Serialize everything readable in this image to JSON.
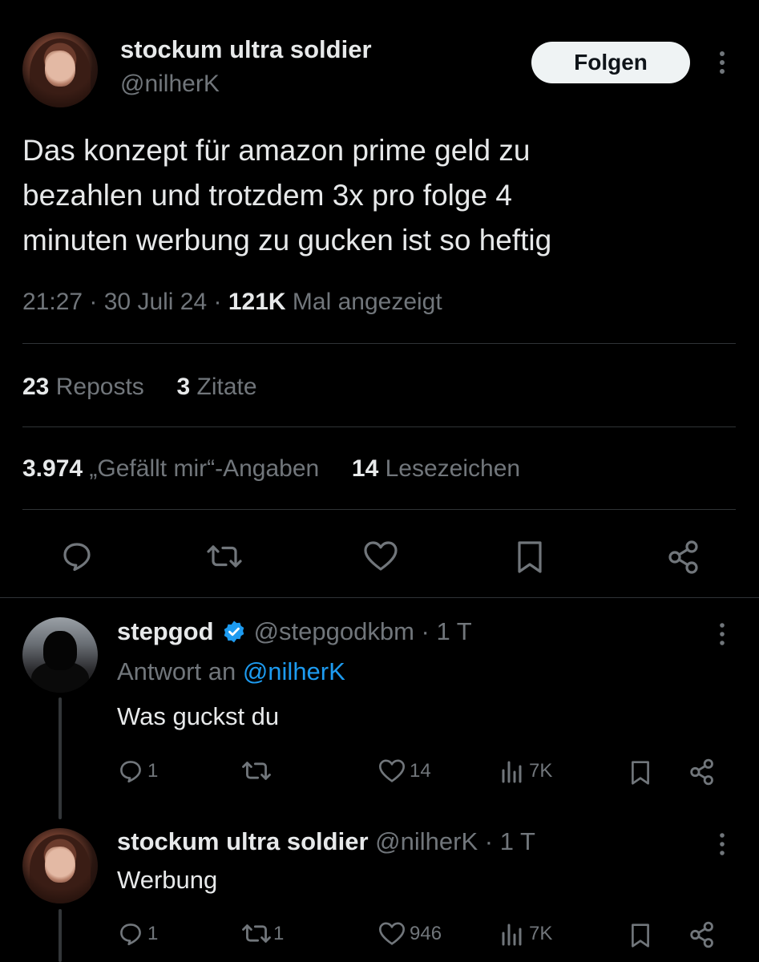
{
  "main_tweet": {
    "author_name": "stockum ultra soldier",
    "author_handle": "@nilherK",
    "follow_label": "Folgen",
    "text_lines": [
      "Das konzept für amazon prime geld zu",
      "bezahlen und trotzdem 3x pro folge 4",
      "minuten werbung zu gucken ist so heftig"
    ],
    "time": "21:27",
    "date": "30 Juli 24",
    "views_count": "121K",
    "views_label": "Mal angezeigt",
    "reposts_count": "23",
    "reposts_label": "Reposts",
    "quotes_count": "3",
    "quotes_label": "Zitate",
    "likes_count": "3.974",
    "likes_label": "„Gefällt mir“-Angaben",
    "bookmarks_count": "14",
    "bookmarks_label": "Lesezeichen"
  },
  "replies": [
    {
      "author_name": "stepgod",
      "author_handle": "@stepgodkbm",
      "age": "1 T",
      "reply_to_label": "Antwort an",
      "reply_to_handle": "@nilherK",
      "text": "Was guckst du",
      "replies": "1",
      "reposts": "",
      "likes": "14",
      "views": "7K"
    },
    {
      "author_name": "stockum ultra soldier",
      "author_handle": "@nilherK",
      "age": "1 T",
      "text": "Werbung",
      "replies": "1",
      "reposts": "1",
      "likes": "946",
      "views": "7K"
    }
  ],
  "icons": {
    "more": "more-icon",
    "reply": "reply-icon",
    "repost": "repost-icon",
    "like": "like-icon",
    "bookmark": "bookmark-icon",
    "share": "share-icon",
    "views": "views-icon",
    "verified": "verified-badge-icon"
  },
  "colors": {
    "background": "#000000",
    "text": "#e7e9ea",
    "muted": "#71767b",
    "link": "#1d9bf0",
    "divider": "#2f3336"
  }
}
